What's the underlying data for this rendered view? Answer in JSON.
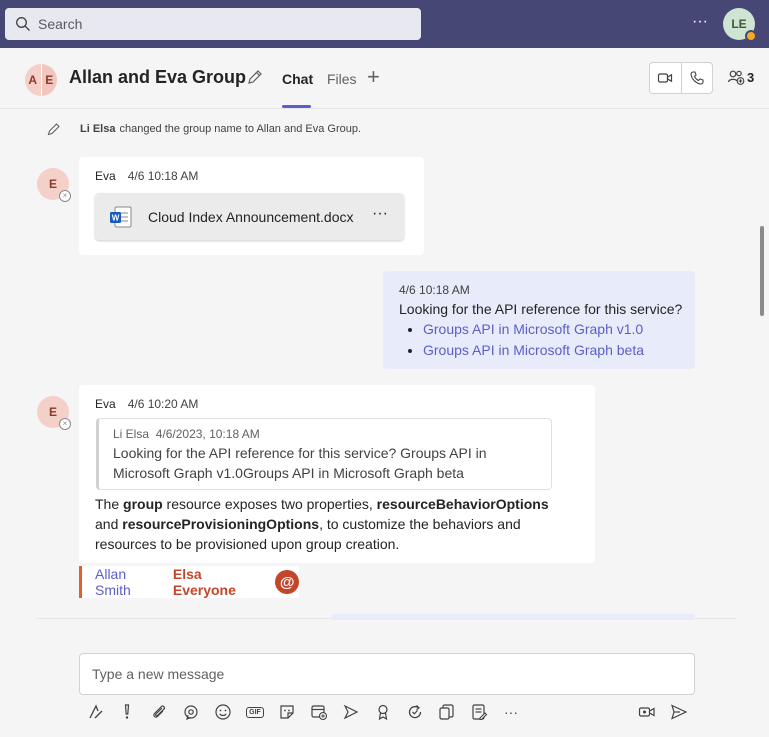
{
  "topbar": {
    "search_placeholder": "Search",
    "more_label": "···",
    "user_initials": "LE"
  },
  "header": {
    "group_initials": [
      "A",
      "E"
    ],
    "title": "Allan and Eva Group",
    "tabs": [
      {
        "label": "Chat",
        "active": true
      },
      {
        "label": "Files",
        "active": false
      }
    ],
    "add_tab_label": "+",
    "participants_count": "3"
  },
  "system_message": {
    "actor": "Li Elsa",
    "text": "changed the group name to Allan and Eva Group."
  },
  "messages": [
    {
      "avatar": "E",
      "author": "Eva",
      "time": "4/6 10:18 AM",
      "file": {
        "name": "Cloud Index Announcement.docx",
        "more": "···"
      }
    },
    {
      "mine": true,
      "time": "4/6 10:18 AM",
      "text": "Looking for the API reference for this service?",
      "links": [
        "Groups API in Microsoft Graph v1.0",
        "Groups API in Microsoft Graph beta"
      ]
    },
    {
      "avatar": "E",
      "author": "Eva",
      "time": "4/6 10:20 AM",
      "quote": {
        "author": "Li Elsa",
        "time": "4/6/2023, 10:18 AM",
        "text": "Looking for the API reference for this service? Groups API in Microsoft Graph v1.0Groups API in Microsoft Graph beta"
      },
      "body": {
        "t1": "The ",
        "b1": "group",
        "t2": " resource exposes two properties, ",
        "b2": "resourceBehaviorOptions",
        "t3": " and ",
        "b3": "resourceProvisioningOptions",
        "t4": ", to customize the behaviors and resources to be provisioned upon group creation."
      },
      "mentions": {
        "m1": "Allan Smith",
        "m2": "Elsa Everyone",
        "badge": "@"
      }
    }
  ],
  "compose": {
    "placeholder": "Type a new message",
    "toolbar": [
      "format-icon",
      "important-icon",
      "attach-icon",
      "loop-icon",
      "emoji-icon",
      "gif-icon",
      "sticker-icon",
      "schedule-meeting-icon",
      "stream-icon",
      "praise-icon",
      "approvals-icon",
      "updates-icon",
      "forms-icon",
      "more-icon"
    ],
    "gif_label": "GIF",
    "more_label": "···"
  },
  "colors": {
    "topbar": "#464775",
    "accent": "#5b5fc7",
    "mention": "#c4462a",
    "mine_bubble": "#e8ebfa"
  }
}
